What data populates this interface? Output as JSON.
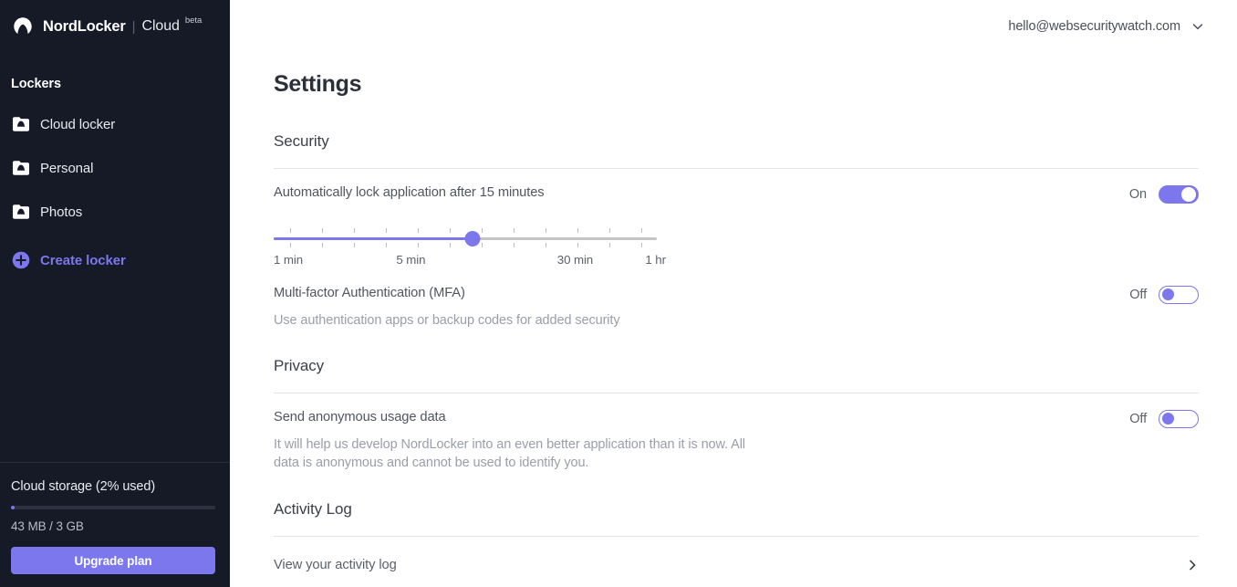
{
  "brand": {
    "logo_icon": "nordlocker-mountain-logo",
    "name": "NordLocker",
    "separator": "|",
    "product": "Cloud",
    "badge": "beta"
  },
  "sidebar": {
    "section_label": "Lockers",
    "items": [
      {
        "label": "Cloud locker",
        "icon": "locker-folder-icon"
      },
      {
        "label": "Personal",
        "icon": "locker-folder-icon"
      },
      {
        "label": "Photos",
        "icon": "locker-folder-icon"
      }
    ],
    "create": {
      "label": "Create locker",
      "icon": "plus-circle-icon"
    },
    "storage": {
      "title": "Cloud storage (2% used)",
      "percent_used": 2,
      "detail": "43 MB / 3 GB",
      "upgrade_label": "Upgrade plan"
    }
  },
  "topbar": {
    "account_email": "hello@websecuritywatch.com",
    "chevron_icon": "chevron-down-icon"
  },
  "page": {
    "title": "Settings"
  },
  "security": {
    "title": "Security",
    "autolock": {
      "title": "Automatically lock application after 15 minutes",
      "state_label": "On",
      "state_on": true,
      "slider": {
        "value_percent": 52,
        "tick_count": 12,
        "labels": [
          {
            "text": "1 min",
            "pos_percent": 0
          },
          {
            "text": "5 min",
            "pos_percent": 32
          },
          {
            "text": "30 min",
            "pos_percent": 74
          },
          {
            "text": "1 hr",
            "pos_percent": 97
          }
        ]
      }
    },
    "mfa": {
      "title": "Multi-factor Authentication (MFA)",
      "description": "Use authentication apps or backup codes for added security",
      "state_label": "Off",
      "state_on": false
    }
  },
  "privacy": {
    "title": "Privacy",
    "usage_data": {
      "title": "Send anonymous usage data",
      "description": "It will help us develop NordLocker into an even better application than it is now. All data is anonymous and cannot be used to identify you.",
      "state_label": "Off",
      "state_on": false
    }
  },
  "activity_log": {
    "title": "Activity Log",
    "link_label": "View your activity log",
    "chevron_icon": "chevron-right-icon"
  },
  "colors": {
    "accent": "#7c77ed",
    "sidebar_bg": "#151a26",
    "text_primary": "#2c3038",
    "text_secondary": "#50555f",
    "text_muted": "#9a9ea8",
    "divider": "#e3e4e8"
  }
}
